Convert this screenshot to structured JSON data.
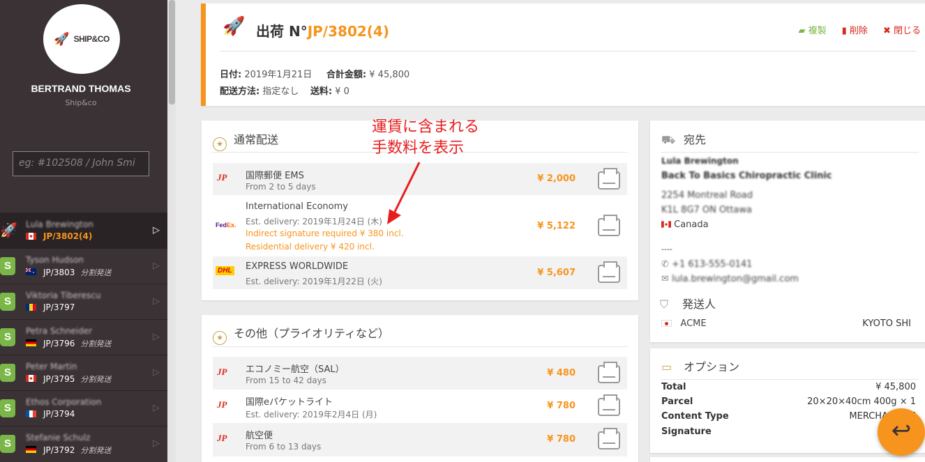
{
  "sidebar": {
    "user_name": "BERTRAND THOMAS",
    "company": "Ship&co",
    "logo_text": "SHIP&CO",
    "search_placeholder": "eg: #102508 / John Smi",
    "shipments": [
      {
        "name": "Lula Brewington",
        "number": "JP/3802(4)",
        "split": "",
        "flag": "CA",
        "icon": "rocket",
        "active": true
      },
      {
        "name": "Tyson Hudson",
        "number": "JP/3803",
        "split": "分割発送",
        "flag": "AU",
        "icon": "shopify",
        "active": false
      },
      {
        "name": "Viktoria Tiberescu",
        "number": "JP/3797",
        "split": "",
        "flag": "RO",
        "icon": "shopify",
        "active": false
      },
      {
        "name": "Petra Schneider",
        "number": "JP/3796",
        "split": "分割発送",
        "flag": "DE",
        "icon": "shopify",
        "active": false
      },
      {
        "name": "Peter Martin",
        "number": "JP/3795",
        "split": "分割発送",
        "flag": "CA",
        "icon": "shopify",
        "active": false
      },
      {
        "name": "Ethos Corporation",
        "number": "JP/3794",
        "split": "",
        "flag": "FR",
        "icon": "shopify",
        "active": false
      },
      {
        "name": "Stefanie Schulz",
        "number": "JP/3792",
        "split": "分割発送",
        "flag": "DE",
        "icon": "shopify",
        "active": false
      }
    ]
  },
  "header": {
    "title_prefix": "出荷 N°",
    "title_number": "JP/3802(4)",
    "actions": {
      "copy": "複製",
      "delete": "削除",
      "close": "閉じる"
    },
    "date_label": "日付:",
    "date_value": "2019年1月21日",
    "total_label": "合計金額:",
    "total_value": "¥ 45,800",
    "method_label": "配送方法:",
    "method_value": "指定なし",
    "fee_label": "送料:",
    "fee_value": "¥ 0"
  },
  "standard": {
    "title": "通常配送",
    "rates": [
      {
        "carrier": "jp",
        "name": "国際郵便 EMS",
        "sub": "From 2 to 5 days",
        "notes": [],
        "price": "¥ 2,000"
      },
      {
        "carrier": "fedex",
        "name": "International Economy",
        "sub": "Est. delivery: 2019年1月24日 (木)",
        "notes": [
          "Indirect signature required ¥ 380 incl.",
          "Residential delivery ¥ 420 incl."
        ],
        "price": "¥ 5,122"
      },
      {
        "carrier": "dhl",
        "name": "EXPRESS WORLDWIDE",
        "sub": "Est. delivery: 2019年1月22日 (火)",
        "notes": [],
        "price": "¥ 5,607"
      }
    ]
  },
  "other": {
    "title": "その他（プライオリティなど）",
    "rates": [
      {
        "carrier": "jp",
        "name": "エコノミー航空（SAL）",
        "sub": "From 15 to 42 days",
        "price": "¥ 480"
      },
      {
        "carrier": "jp",
        "name": "国際eパケットライト",
        "sub": "Est. delivery: 2019年2月4日 (月)",
        "price": "¥ 780"
      },
      {
        "carrier": "jp",
        "name": "航空便",
        "sub": "From 6 to 13 days",
        "price": "¥ 780"
      }
    ]
  },
  "annotation": {
    "line1": "運賃に含まれる",
    "line2": "手数料を表示"
  },
  "recipient": {
    "title": "宛先",
    "name": "Lula Brewington",
    "company": "Back To Basics Chiropractic Clinic",
    "address1": "2254 Montreal Road",
    "address2": "K1L 8G7 ON Ottawa",
    "country": "Canada",
    "separator": "----",
    "phone": "+1 613-555-0141",
    "email": "lula.brewington@gmail.com"
  },
  "sender": {
    "title": "発送人",
    "name": "ACME",
    "city": "KYOTO SHI"
  },
  "options": {
    "title": "オプション",
    "rows": [
      {
        "label": "Total",
        "value": "¥ 45,800"
      },
      {
        "label": "Parcel",
        "value": "20×20×40cm 400g × 1"
      },
      {
        "label": "Content Type",
        "value": "MERCHANDISE"
      },
      {
        "label": "Signature",
        "value": ""
      }
    ]
  },
  "colors": {
    "accent": "#f7941d",
    "sidebar": "#3a3235",
    "danger": "#d9281d",
    "success": "#7ab648"
  }
}
